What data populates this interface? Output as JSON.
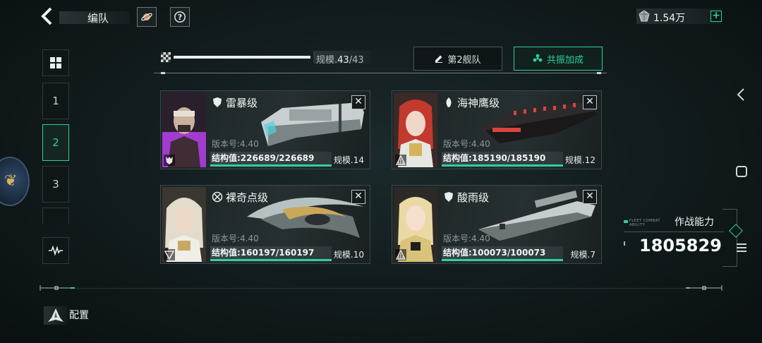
{
  "header": {
    "title": "编队",
    "resource_value": "1.54万",
    "resource_plus": "+"
  },
  "sidebar": {
    "fleets": [
      "1",
      "2",
      "3"
    ],
    "active_fleet": "2"
  },
  "progress": {
    "label": "规模.",
    "current": "43",
    "max": "/43",
    "fraction": 1.0
  },
  "toolbar": {
    "fleet_button": "第2舰队",
    "resonance_button": "共振加成"
  },
  "ships": [
    {
      "name": "雷暴级",
      "version": "版本号:4.40",
      "structure": "结构值:226689/226689",
      "hp_fraction": 1.0,
      "scale": "规模.14",
      "portrait_color": "#a23bd0"
    },
    {
      "name": "海神鹰级",
      "version": "版本号:4.40",
      "structure": "结构值:185190/185190",
      "hp_fraction": 1.0,
      "scale": "规模.12",
      "portrait_color": "#c23a2e"
    },
    {
      "name": "裸奇点级",
      "version": "版本号:4.40",
      "structure": "结构值:160197/160197",
      "hp_fraction": 1.0,
      "scale": "规模.10",
      "portrait_color": "#c7a865"
    },
    {
      "name": "酸雨级",
      "version": "版本号:4.40",
      "structure": "结构值:100073/100073",
      "hp_fraction": 1.0,
      "scale": "规模.7",
      "portrait_color": "#d9c27a"
    }
  ],
  "combat": {
    "tag": "FLEET COMBAT ABILITY",
    "label": "作战能力",
    "value": "1805829"
  },
  "footer": {
    "config_label": "配置"
  },
  "colors": {
    "accent": "#2fd19a",
    "background": "#111a1c"
  }
}
